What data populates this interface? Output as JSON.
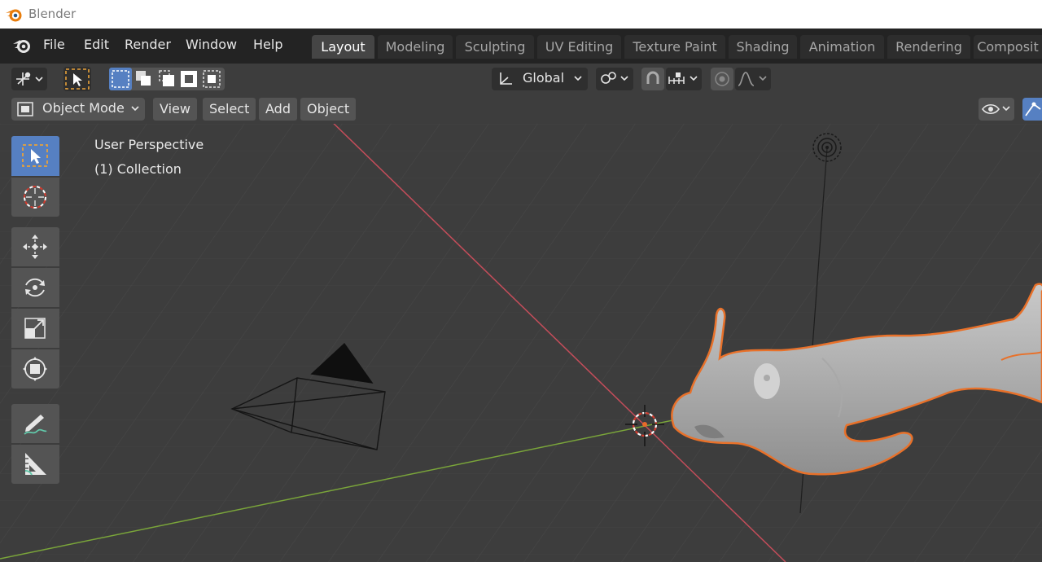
{
  "window": {
    "title": "Blender"
  },
  "menubar": {
    "items": [
      "File",
      "Edit",
      "Render",
      "Window",
      "Help"
    ]
  },
  "workspaces": {
    "tabs": [
      "Layout",
      "Modeling",
      "Sculpting",
      "UV Editing",
      "Texture Paint",
      "Shading",
      "Animation",
      "Rendering",
      "Composit"
    ],
    "active": "Layout"
  },
  "toolbar": {
    "transform_orientation": "Global"
  },
  "header": {
    "mode": "Object Mode",
    "menus": [
      "View",
      "Select",
      "Add",
      "Object"
    ]
  },
  "viewport": {
    "perspective": "User Perspective",
    "collection": "(1) Collection"
  },
  "colors": {
    "accent": "#5680c2",
    "selection_outline": "#e8712a",
    "x_axis": "#c44d5a",
    "y_axis": "#7aa53a"
  }
}
